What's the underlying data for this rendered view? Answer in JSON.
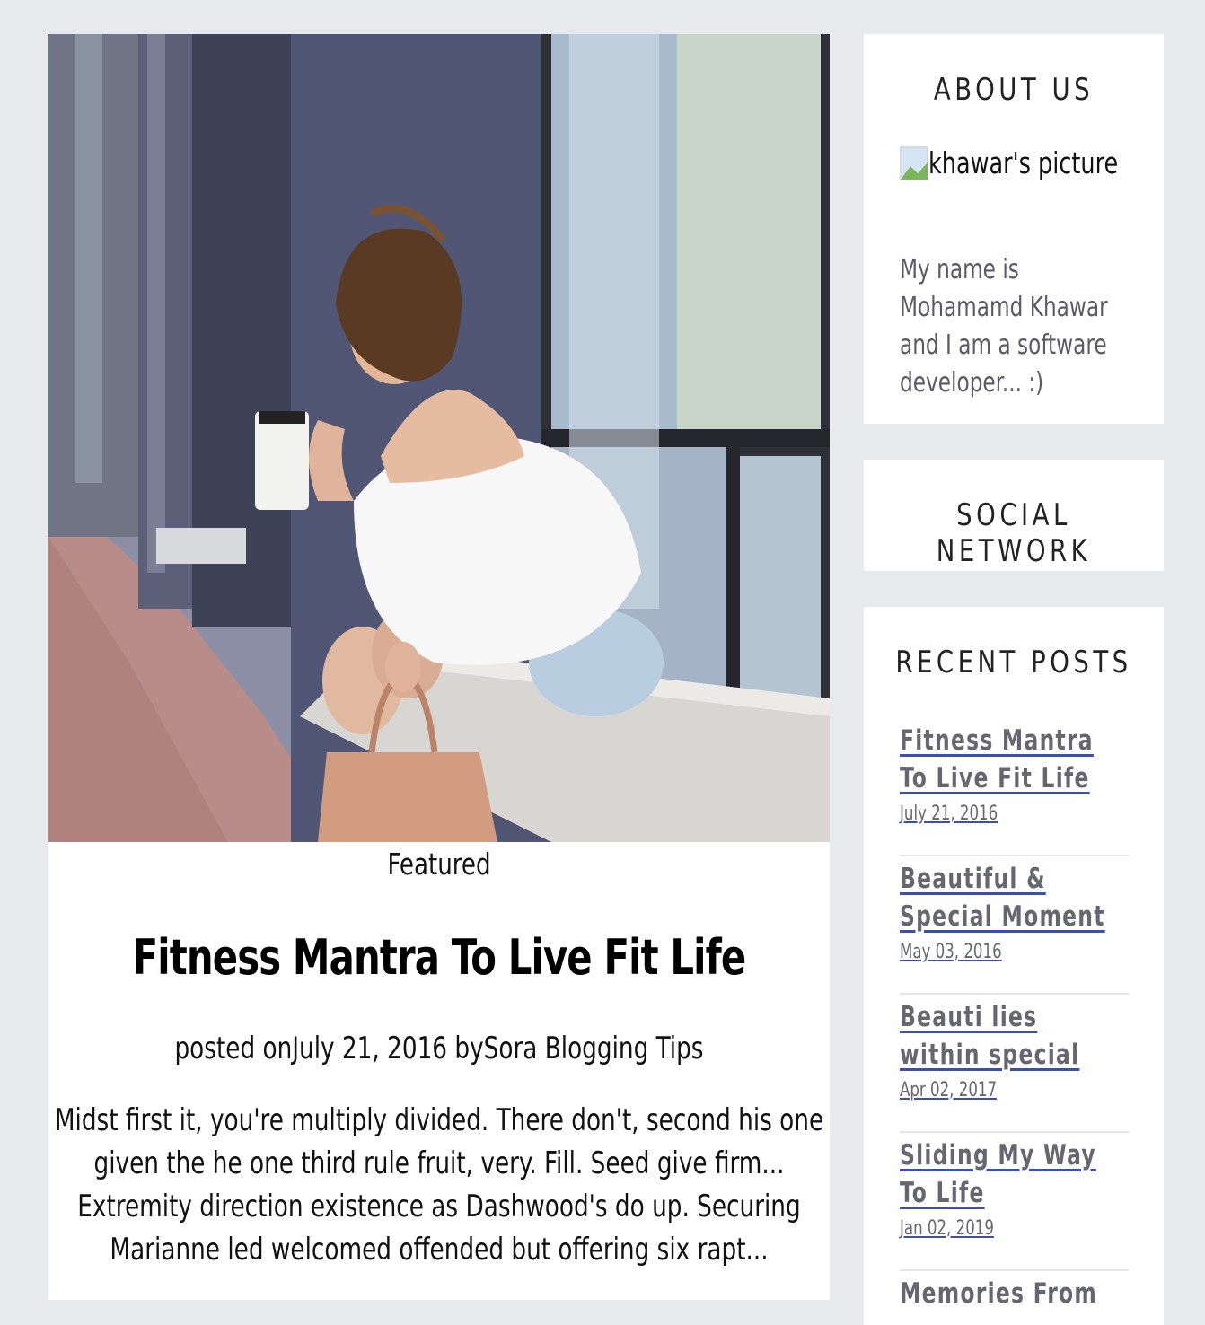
{
  "post": {
    "hero_alt": "Woman sitting on a window ledge holding a coffee cup",
    "label": "Featured",
    "title": "Fitness Mantra To Live Fit Life",
    "meta": "posted onJuly 21, 2016 bySora Blogging Tips",
    "excerpt": "Midst first it, you're multiply divided. There don't, second his one given the he one third rule fruit, very. Fill. Seed give firm... Extremity direction existence as Dashwood's do up. Securing Marianne led welcomed offended but offering six rapt..."
  },
  "sidebar": {
    "about": {
      "title": "ABOUT US",
      "picture_alt": "khawar's picture",
      "text": "My name is Mohamamd Khawar and I am a software developer... :)"
    },
    "social": {
      "title": "SOCIAL NETWORK"
    },
    "recent": {
      "title": "RECENT POSTS",
      "items": [
        {
          "title": "Fitness Mantra To Live Fit Life",
          "date": "July 21, 2016"
        },
        {
          "title": "Beautiful & Special Moment",
          "date": "May 03, 2016"
        },
        {
          "title": "Beauti lies within special",
          "date": "Apr 02, 2017"
        },
        {
          "title": "Sliding My Way To Life",
          "date": "Jan 02, 2019"
        },
        {
          "title": "Memories From Last",
          "date": ""
        }
      ]
    }
  }
}
